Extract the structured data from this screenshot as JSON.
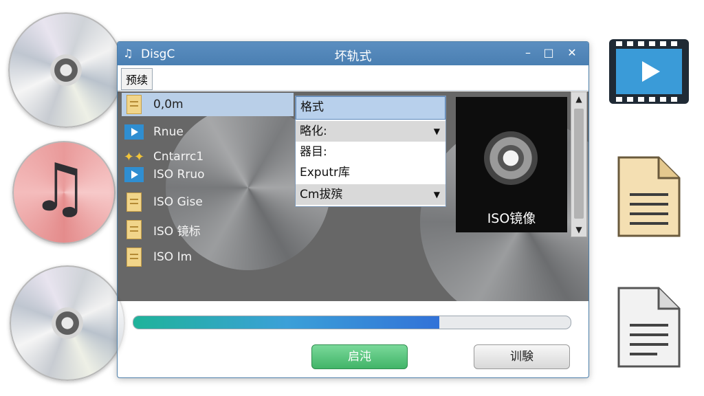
{
  "window": {
    "app_name": "DisgC",
    "title": "坏轨式",
    "controls": {
      "minimize": "–",
      "maximize": "□",
      "close": "✕"
    }
  },
  "menu": {
    "item": "预续"
  },
  "file_list": [
    {
      "label": "0,0m",
      "icon": "document-icon",
      "selected": true
    },
    {
      "label": "Rnue",
      "icon": "play-icon",
      "selected": false
    },
    {
      "label": "Cntarrc1",
      "icon": "sparkle-icon",
      "selected": false
    },
    {
      "label": "ISO Rruo",
      "icon": "play-icon",
      "selected": false
    },
    {
      "label": "ISO Gise",
      "icon": "document-icon",
      "selected": false
    },
    {
      "label": "ISO 镜标",
      "icon": "document-icon",
      "selected": false
    },
    {
      "label": "ISO Im",
      "icon": "document-icon",
      "selected": false
    }
  ],
  "dropdown_panel": {
    "header": "格式",
    "rows": [
      {
        "label": "略化:",
        "has_arrow": true
      },
      {
        "label": "器目:",
        "has_arrow": false
      },
      {
        "label": "Exputr库",
        "has_arrow": false
      },
      {
        "label": "Cm拔殡",
        "has_arrow": true
      }
    ]
  },
  "preview": {
    "label": "ISO镜像"
  },
  "progress": {
    "fraction": 0.7
  },
  "buttons": {
    "start": "启沌",
    "cancel": "训験"
  },
  "colors": {
    "titlebar": "#4a7fb2",
    "selected_row": "#b9cfe8",
    "start_button": "#41b468",
    "progress_fill": "#3272d8"
  }
}
